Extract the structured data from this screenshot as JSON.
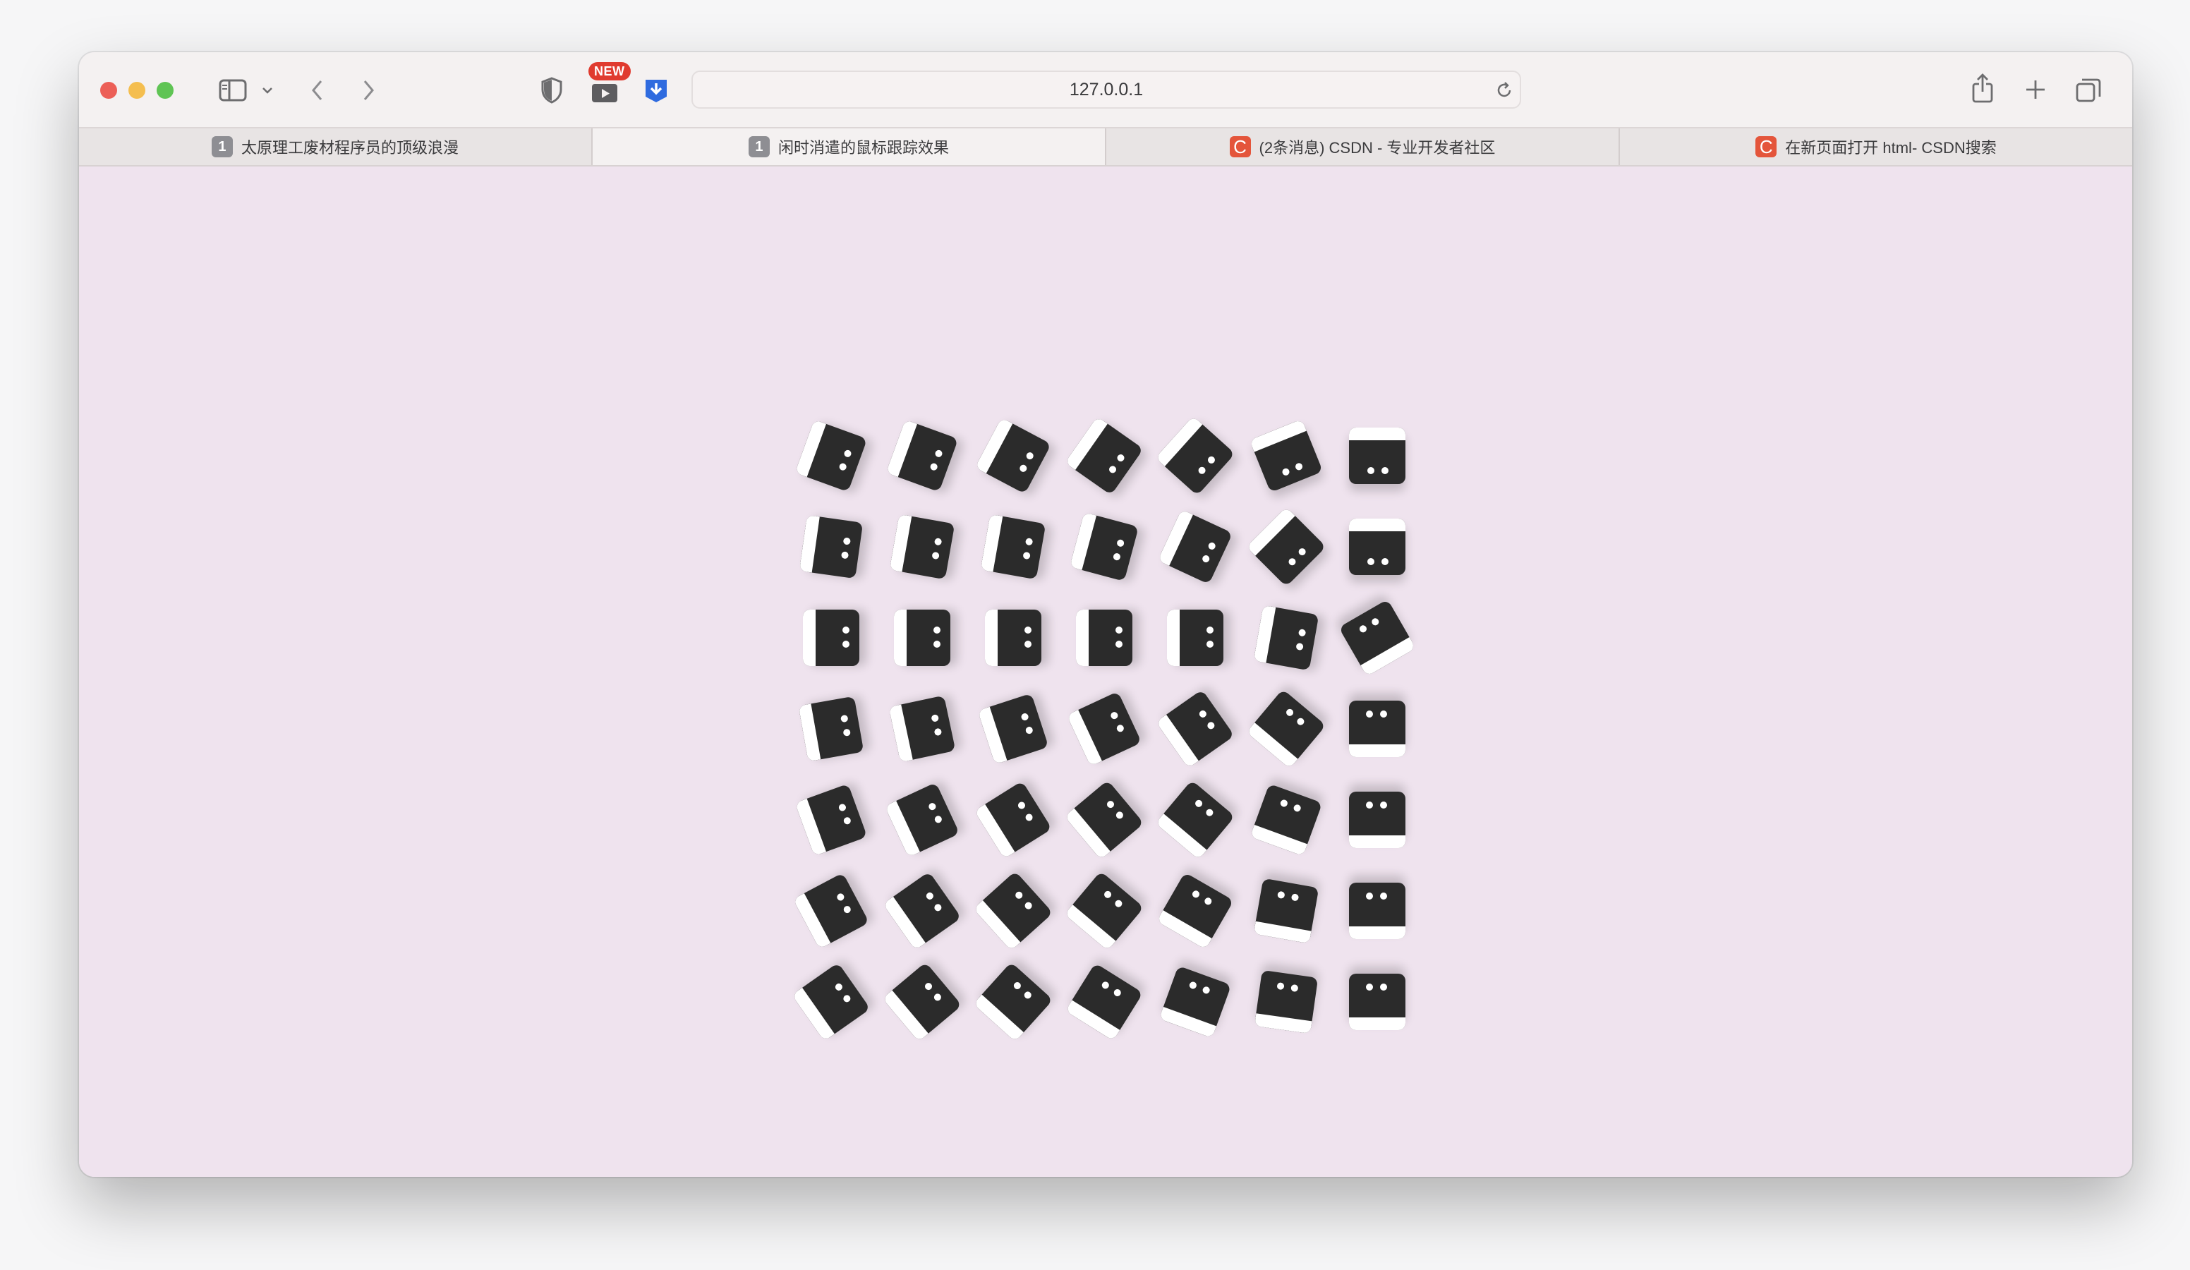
{
  "window": {
    "new_badge": "NEW",
    "address": "127.0.0.1",
    "icons": [
      "close-dot",
      "minimize-dot",
      "zoom-dot",
      "sidebar-icon",
      "chevron-down-icon",
      "back-icon",
      "forward-icon",
      "shield-icon",
      "video-extension-icon",
      "download-extension-icon",
      "reload-icon",
      "share-icon",
      "new-tab-icon",
      "tab-overview-icon"
    ]
  },
  "tabs": [
    {
      "favicon": "1",
      "favicon_type": "num",
      "title": "太原理工废材程序员的顶级浪漫",
      "active": false
    },
    {
      "favicon": "1",
      "favicon_type": "num",
      "title": "闲时消遣的鼠标跟踪效果",
      "active": true
    },
    {
      "favicon": "C",
      "favicon_type": "csdn",
      "title": "(2条消息) CSDN - 专业开发者社区",
      "active": false
    },
    {
      "favicon": "C",
      "favicon_type": "csdn",
      "title": "在新页面打开 html- CSDN搜索",
      "active": false
    }
  ],
  "page": {
    "grid_rows": 7,
    "grid_cols": 7,
    "face_color": "#2b2b2b",
    "strip_color": "#ffffff",
    "background": "#efe3ee",
    "angles": [
      [
        -70,
        -70,
        -62,
        -55,
        -48,
        -22,
        0
      ],
      [
        -82,
        -80,
        -80,
        -75,
        -65,
        -45,
        0
      ],
      [
        -90,
        -90,
        -90,
        -90,
        -90,
        -80,
        150
      ],
      [
        -100,
        -102,
        -108,
        -115,
        -125,
        -140,
        180
      ],
      [
        -110,
        -115,
        -122,
        -130,
        -140,
        -160,
        180
      ],
      [
        -118,
        -125,
        -132,
        -140,
        -150,
        -170,
        180
      ],
      [
        -125,
        -130,
        -138,
        -148,
        -160,
        -172,
        180
      ]
    ]
  }
}
